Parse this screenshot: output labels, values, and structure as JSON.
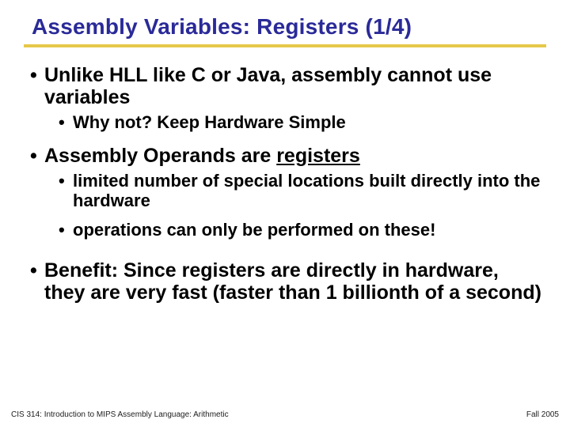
{
  "title": "Assembly Variables: Registers (1/4)",
  "bullets": {
    "b1a": "Unlike HLL like C or Java, assembly cannot use variables",
    "b2a": "Why not? Keep Hardware Simple",
    "b1b_pre": "Assembly Operands are ",
    "b1b_u": "registers",
    "b2b": "limited number of special locations built directly into the hardware",
    "b2c": "operations can only be performed on these!",
    "b1c": "Benefit: Since registers are directly in hardware, they are very fast (faster than 1 billionth of a second)"
  },
  "footer": {
    "left": "CIS 314: Introduction to MIPS Assembly Language: Arithmetic",
    "right": "Fall 2005"
  },
  "bullet_char": "•"
}
